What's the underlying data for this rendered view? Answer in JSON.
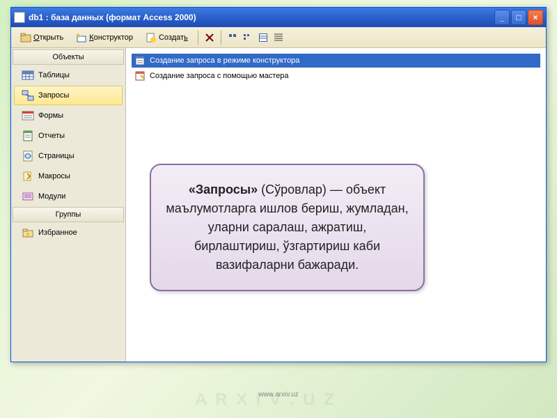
{
  "watermark_text": "A R X I V . U Z",
  "window": {
    "title": "db1 : база данных (формат Access 2000)"
  },
  "toolbar": {
    "open_label": "Открыть",
    "design_label": "Конструктор",
    "create_label": "Создать"
  },
  "sidebar": {
    "header_objects": "Объекты",
    "items": [
      {
        "label": "Таблицы"
      },
      {
        "label": "Запросы"
      },
      {
        "label": "Формы"
      },
      {
        "label": "Отчеты"
      },
      {
        "label": "Страницы"
      },
      {
        "label": "Макросы"
      },
      {
        "label": "Модули"
      }
    ],
    "header_groups": "Группы",
    "group_items": [
      {
        "label": "Избранное"
      }
    ]
  },
  "main": {
    "items": [
      {
        "label": "Создание запроса в режиме конструктора"
      },
      {
        "label": "Создание запроса с помощью мастера"
      }
    ]
  },
  "callout": {
    "bold": "«Запросы»",
    "paren": " (Сўровлар) — ",
    "rest": "объект маълумотларга ишлов бериш, жумладан, уларни саралаш, ажратиш, бирлаштириш, ўзгартириш каби вазифаларни бажаради."
  },
  "footer": {
    "url": "www.arxiv.uz"
  }
}
